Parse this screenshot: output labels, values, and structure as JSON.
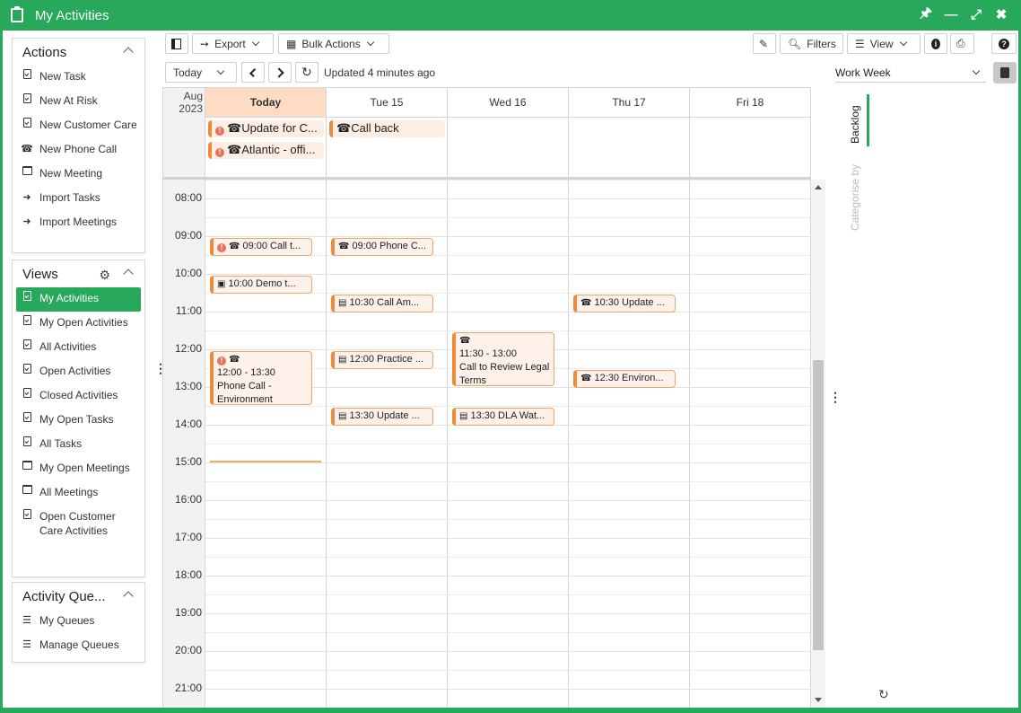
{
  "window": {
    "title": "My Activities"
  },
  "actions_panel": {
    "title": "Actions",
    "items": [
      {
        "label": "New Task",
        "icon": "task-icon"
      },
      {
        "label": "New At Risk",
        "icon": "task-icon"
      },
      {
        "label": "New Customer Care",
        "icon": "task-icon"
      },
      {
        "label": "New Phone Call",
        "icon": "phone-icon"
      },
      {
        "label": "New Meeting",
        "icon": "calendar-icon"
      },
      {
        "label": "Import Tasks",
        "icon": "import-icon"
      },
      {
        "label": "Import Meetings",
        "icon": "import-icon"
      }
    ]
  },
  "views_panel": {
    "title": "Views",
    "items": [
      {
        "label": "My Activities",
        "active": true
      },
      {
        "label": "My Open Activities"
      },
      {
        "label": "All Activities"
      },
      {
        "label": "Open Activities"
      },
      {
        "label": "Closed Activities"
      },
      {
        "label": "My Open Tasks"
      },
      {
        "label": "All Tasks"
      },
      {
        "label": "My Open Meetings"
      },
      {
        "label": "All Meetings"
      },
      {
        "label": "Open Customer Care Activities"
      }
    ]
  },
  "queues_panel": {
    "title": "Activity Que...",
    "items": [
      {
        "label": "My Queues"
      },
      {
        "label": "Manage Queues"
      }
    ]
  },
  "toolbar": {
    "export": "Export",
    "bulk_actions": "Bulk Actions",
    "filters": "Filters",
    "view": "View",
    "today": "Today",
    "updated": "Updated 4 minutes ago",
    "view_mode": "Work Week"
  },
  "calendar": {
    "month": "Aug",
    "year": "2023",
    "days": [
      "Today",
      "Tue 15",
      "Wed 16",
      "Thu 17",
      "Fri 18"
    ],
    "hours": [
      "08:00",
      "09:00",
      "10:00",
      "11:00",
      "12:00",
      "13:00",
      "14:00",
      "15:00",
      "16:00",
      "17:00",
      "18:00",
      "19:00",
      "20:00",
      "21:00"
    ],
    "allday": [
      {
        "day": 0,
        "row": 0,
        "text": "Update for C...",
        "alert": true
      },
      {
        "day": 0,
        "row": 1,
        "text": "Atlantic - offi...",
        "alert": true
      },
      {
        "day": 1,
        "row": 0,
        "text": "Call back",
        "alert": false
      }
    ],
    "events": [
      {
        "day": 0,
        "start": 9.0,
        "end": 9.5,
        "text": "09:00 Call t...",
        "type": "phone",
        "alert": true
      },
      {
        "day": 1,
        "start": 9.0,
        "end": 10.0,
        "text": "09:00 Phone C...",
        "type": "phone",
        "alert": false
      },
      {
        "day": 0,
        "start": 10.0,
        "end": 10.5,
        "text": "10:00 Demo t...",
        "type": "meeting",
        "alert": false
      },
      {
        "day": 1,
        "start": 10.5,
        "end": 11.0,
        "text": "10:30 Call Am...",
        "type": "task",
        "alert": false
      },
      {
        "day": 3,
        "start": 10.5,
        "end": 11.0,
        "text": "10:30 Update ...",
        "type": "phone",
        "alert": false
      },
      {
        "day": 2,
        "start": 11.5,
        "end": 13.0,
        "time": "11:30 - 13:00",
        "text": "Call to Review Legal Terms",
        "type": "phone",
        "alert": false,
        "multi": true
      },
      {
        "day": 0,
        "start": 12.0,
        "end": 13.5,
        "time": "12:00 - 13:30",
        "text": "Phone Call - Environment",
        "type": "phone",
        "alert": true,
        "multi": true
      },
      {
        "day": 1,
        "start": 12.0,
        "end": 12.5,
        "text": "12:00 Practice ...",
        "type": "task",
        "alert": false
      },
      {
        "day": 3,
        "start": 12.5,
        "end": 13.0,
        "text": "12:30 Environ...",
        "type": "phone",
        "alert": false
      },
      {
        "day": 1,
        "start": 13.5,
        "end": 14.0,
        "text": "13:30 Update ...",
        "type": "task",
        "alert": false
      },
      {
        "day": 2,
        "start": 13.5,
        "end": 14.0,
        "text": "13:30 DLA Wat...",
        "type": "task",
        "alert": false
      }
    ],
    "now_hour": 14.95
  },
  "side_tabs": {
    "backlog": "Backlog",
    "categorise": "Categorise by"
  },
  "colors": {
    "brand": "#27a85a",
    "event_accent": "#ef8a38",
    "today_header": "#fddcc3"
  }
}
